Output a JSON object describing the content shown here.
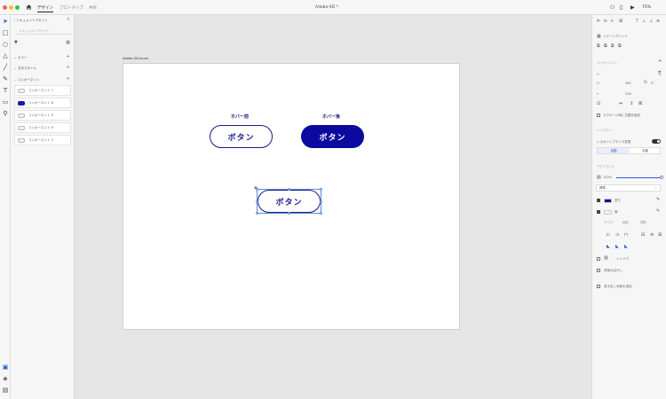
{
  "window": {
    "title": "Adobe-XD *",
    "tabs": [
      "デザイン",
      "プロトタイプ",
      "共有"
    ],
    "zoom": "75%"
  },
  "assets": {
    "back_label": "ドキュメントアセット",
    "search_placeholder": "ドキュメントアセット",
    "sections": [
      "カラー",
      "文字スタイル",
      "コンポーネント"
    ],
    "components": [
      "コンポーネント 7",
      "コンポーネント 8",
      "コンポーネント 5",
      "コンポーネント 6",
      "コンポーネント 3"
    ]
  },
  "canvas": {
    "artboard_name": "Adobe-XD-hover",
    "caption_before": "ホバー前",
    "caption_after": "ホバー後",
    "button_text_before": "ボタン",
    "button_text_after": "ボタン",
    "button_text_selected": "ボタン"
  },
  "inspector": {
    "repeat_grid": "リピートグリッド",
    "component_header": "コンポーネント",
    "w_label": "W",
    "w_value": "380",
    "h_label": "H",
    "h_value": "326",
    "rotation": "0°",
    "scroll_fixed": "スクロール時に位置を固定",
    "layout_header": "レイアウト",
    "responsive_resize": "レスポンシブサイズ変更",
    "auto": "自動",
    "manual": "手動",
    "appearance_header": "アピアランス",
    "opacity": "100%",
    "blend": "標準",
    "fill_label": "塗り",
    "border_label": "線",
    "border_sub": [
      "サイズ",
      "破線",
      "間隔"
    ],
    "shadow": "シャドウ",
    "bg_blur": "背景のぼかし",
    "export": "書き出し対象を追加"
  },
  "colors": {
    "accent": "#0a0aa0",
    "outline": "#1a1a8c"
  }
}
